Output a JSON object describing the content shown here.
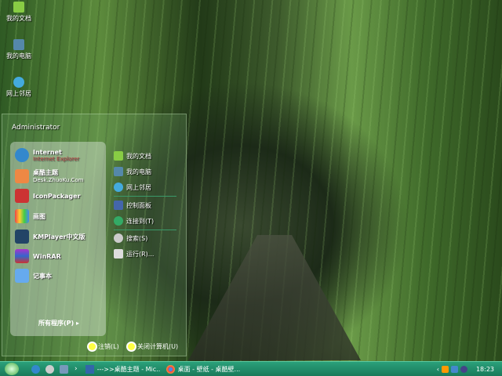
{
  "desktop": {
    "icons": [
      {
        "label": "我的文档"
      },
      {
        "label": "我的电脑"
      },
      {
        "label": "网上邻居"
      }
    ]
  },
  "start_menu": {
    "user": "Administrator",
    "pinned": [
      {
        "label": "Internet",
        "sub": "Internet Explorer",
        "icon": "ie-icon"
      },
      {
        "label": "桌酷主题",
        "sub": "Desk.ZhuoKu.Com",
        "icon": "zhuoku-icon"
      },
      {
        "label": "IconPackager",
        "icon": "iconpackager-icon"
      },
      {
        "label": "画图",
        "icon": "paint-icon"
      },
      {
        "label": "KMPlayer中文版",
        "icon": "kmplayer-icon"
      },
      {
        "label": "WinRAR",
        "icon": "winrar-icon"
      },
      {
        "label": "记事本",
        "icon": "notepad-icon"
      }
    ],
    "all_programs": "所有程序(P)",
    "right": [
      {
        "label": "我的文档"
      },
      {
        "label": "我的电脑"
      },
      {
        "label": "网上邻居"
      },
      {
        "label": "控制面板"
      },
      {
        "label": "连接到(T)"
      },
      {
        "label": "搜索(S)"
      },
      {
        "label": "运行(R)..."
      }
    ],
    "logoff": "注销(L)",
    "shutdown": "关闭计算机(U)"
  },
  "taskbar": {
    "tasks": [
      {
        "label": "--->>桌酷主题 - Mic..."
      },
      {
        "label": "桌面 - 壁纸 - 桌酷壁..."
      }
    ],
    "clock": "18:23",
    "expand": "‹"
  },
  "colors": {
    "taskbar": "#1f8a66"
  }
}
